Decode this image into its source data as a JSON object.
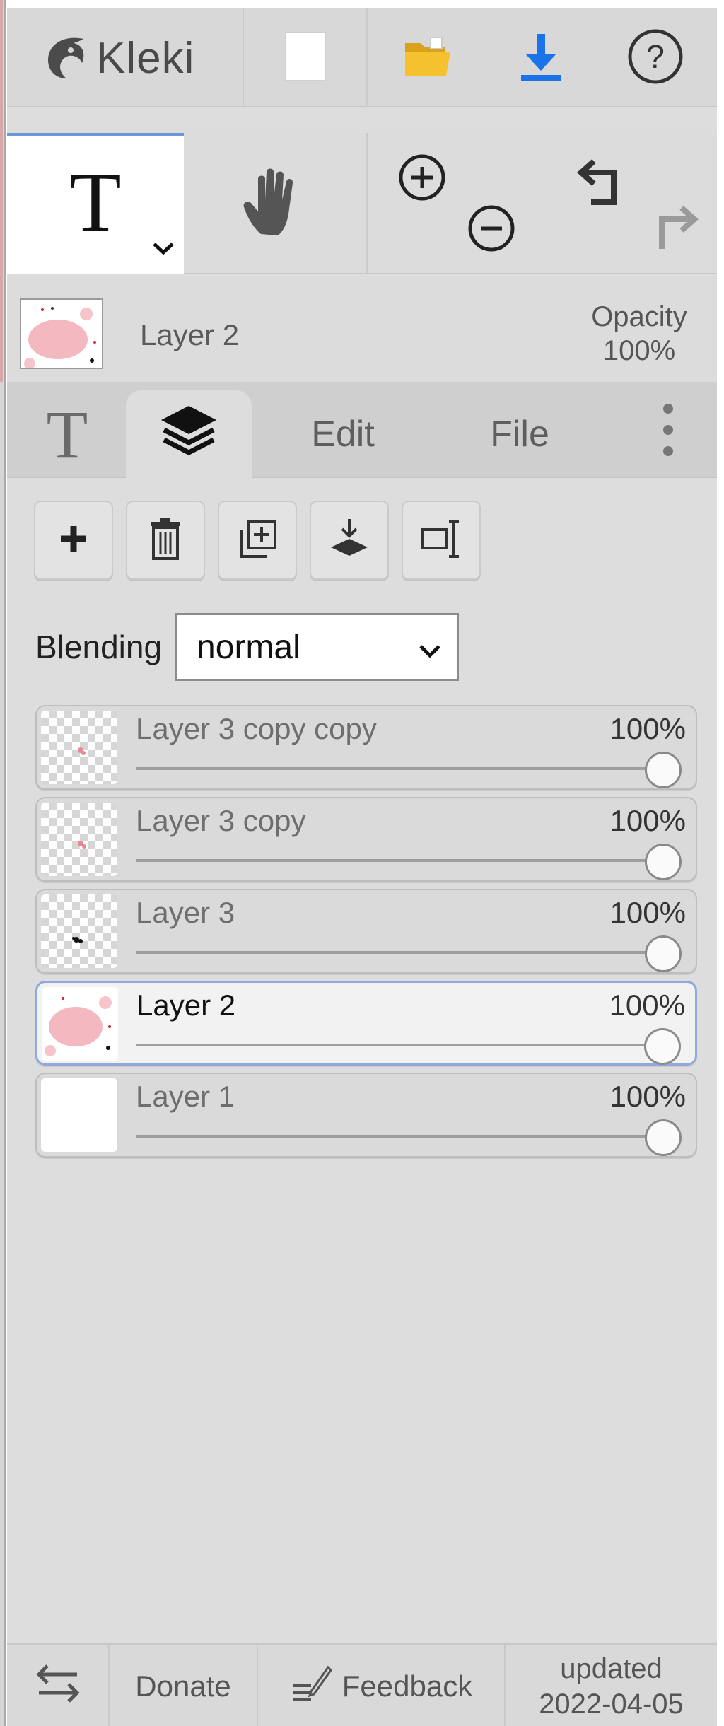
{
  "header": {
    "logo_text": "Kleki",
    "icons": [
      "kleki-logo-icon",
      "new-image-icon",
      "open-folder-icon",
      "download-icon",
      "help-icon"
    ],
    "accent_color": "#1a73e8",
    "folder_color": "#f5c12e"
  },
  "tools": {
    "text_tool_glyph": "T",
    "active_tool": "text",
    "active_border_color": "#6f95d9"
  },
  "layer_info": {
    "name": "Layer 2",
    "opacity_label": "Opacity",
    "opacity_value": "100%"
  },
  "tabs": {
    "text_glyph": "T",
    "edit_label": "Edit",
    "file_label": "File",
    "active": "layers"
  },
  "blending": {
    "label": "Blending",
    "value": "normal"
  },
  "layers": [
    {
      "name": "Layer 3 copy copy",
      "opacity": "100%",
      "opacity_level": 1.0,
      "active": false
    },
    {
      "name": "Layer 3 copy",
      "opacity": "100%",
      "opacity_level": 1.0,
      "active": false
    },
    {
      "name": "Layer 3",
      "opacity": "100%",
      "opacity_level": 1.0,
      "active": false
    },
    {
      "name": "Layer 2",
      "opacity": "100%",
      "opacity_level": 1.0,
      "active": true
    },
    {
      "name": "Layer 1",
      "opacity": "100%",
      "opacity_level": 1.0,
      "active": false
    }
  ],
  "footer": {
    "donate_label": "Donate",
    "feedback_label": "Feedback",
    "updated_label": "updated",
    "updated_date": "2022-04-05"
  }
}
